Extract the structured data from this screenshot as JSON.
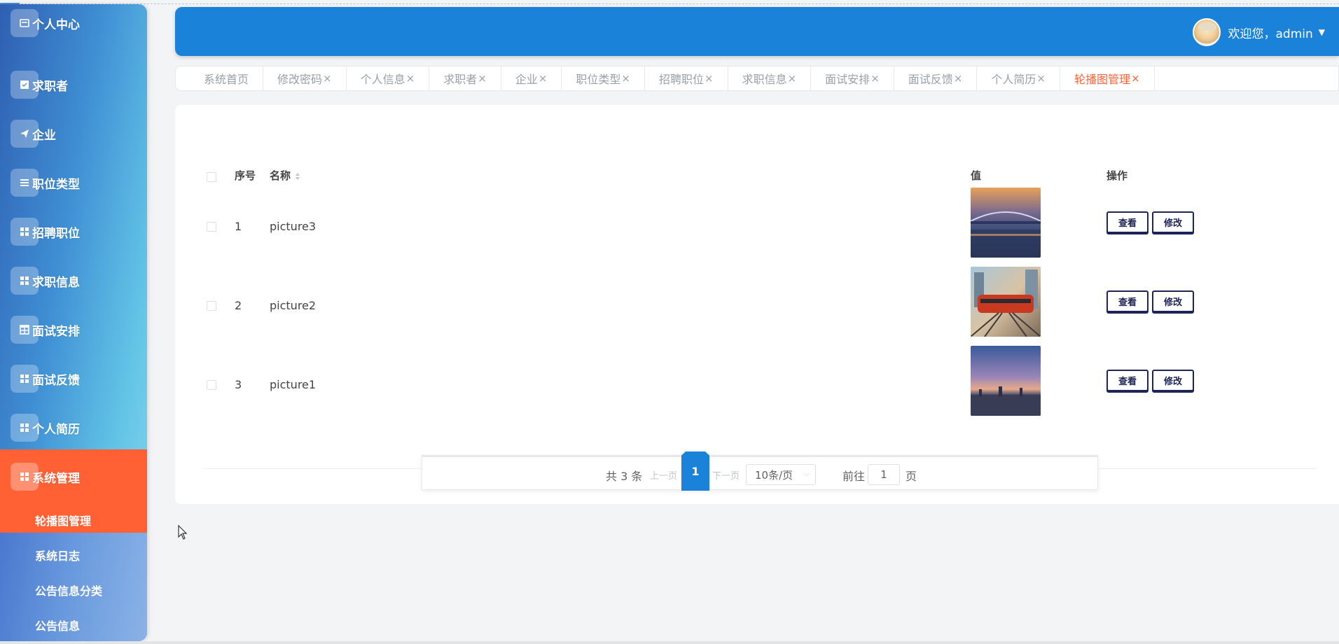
{
  "sidebar": {
    "items": [
      {
        "label": "个人中心",
        "icon": "card-icon"
      },
      {
        "label": "求职者",
        "icon": "checkbox-icon"
      },
      {
        "label": "企业",
        "icon": "send-icon"
      },
      {
        "label": "职位类型",
        "icon": "list-icon"
      },
      {
        "label": "招聘职位",
        "icon": "grid-icon"
      },
      {
        "label": "求职信息",
        "icon": "grid-icon"
      },
      {
        "label": "面试安排",
        "icon": "table-icon"
      },
      {
        "label": "面试反馈",
        "icon": "grid-icon"
      },
      {
        "label": "个人简历",
        "icon": "grid-icon"
      },
      {
        "label": "系统管理",
        "icon": "grid-icon"
      }
    ],
    "submenu": [
      {
        "label": "轮播图管理"
      },
      {
        "label": "系统日志"
      },
      {
        "label": "公告信息分类"
      },
      {
        "label": "公告信息"
      }
    ],
    "active_color": "#ff6135"
  },
  "header": {
    "welcome": "欢迎您，admin",
    "bg_color": "#1a82d9"
  },
  "tabs": [
    {
      "label": "系统首页",
      "closable": ""
    },
    {
      "label": "修改密码",
      "closable": "×"
    },
    {
      "label": "个人信息",
      "closable": "×"
    },
    {
      "label": "求职者",
      "closable": "×"
    },
    {
      "label": "企业",
      "closable": "×"
    },
    {
      "label": "职位类型",
      "closable": "×"
    },
    {
      "label": "招聘职位",
      "closable": "×"
    },
    {
      "label": "求职信息",
      "closable": "×"
    },
    {
      "label": "面试安排",
      "closable": "×"
    },
    {
      "label": "面试反馈",
      "closable": "×"
    },
    {
      "label": "个人简历",
      "closable": "×"
    },
    {
      "label": "轮播图管理",
      "closable": "×"
    }
  ],
  "table": {
    "columns": {
      "index": "序号",
      "name": "名称",
      "value": "值",
      "actions": "操作"
    },
    "rows": [
      {
        "index": "1",
        "name": "picture3",
        "thumb": "bridge-at-dusk"
      },
      {
        "index": "2",
        "name": "picture2",
        "thumb": "red-train"
      },
      {
        "index": "3",
        "name": "picture1",
        "thumb": "city-sunset"
      }
    ],
    "view_label": "查看",
    "edit_label": "修改"
  },
  "pagination": {
    "total": "共 3 条",
    "prev": "上一页",
    "current": "1",
    "next": "下一页",
    "page_size": "10条/页",
    "goto_label": "前往",
    "goto_value": "1",
    "page_suffix": "页"
  }
}
